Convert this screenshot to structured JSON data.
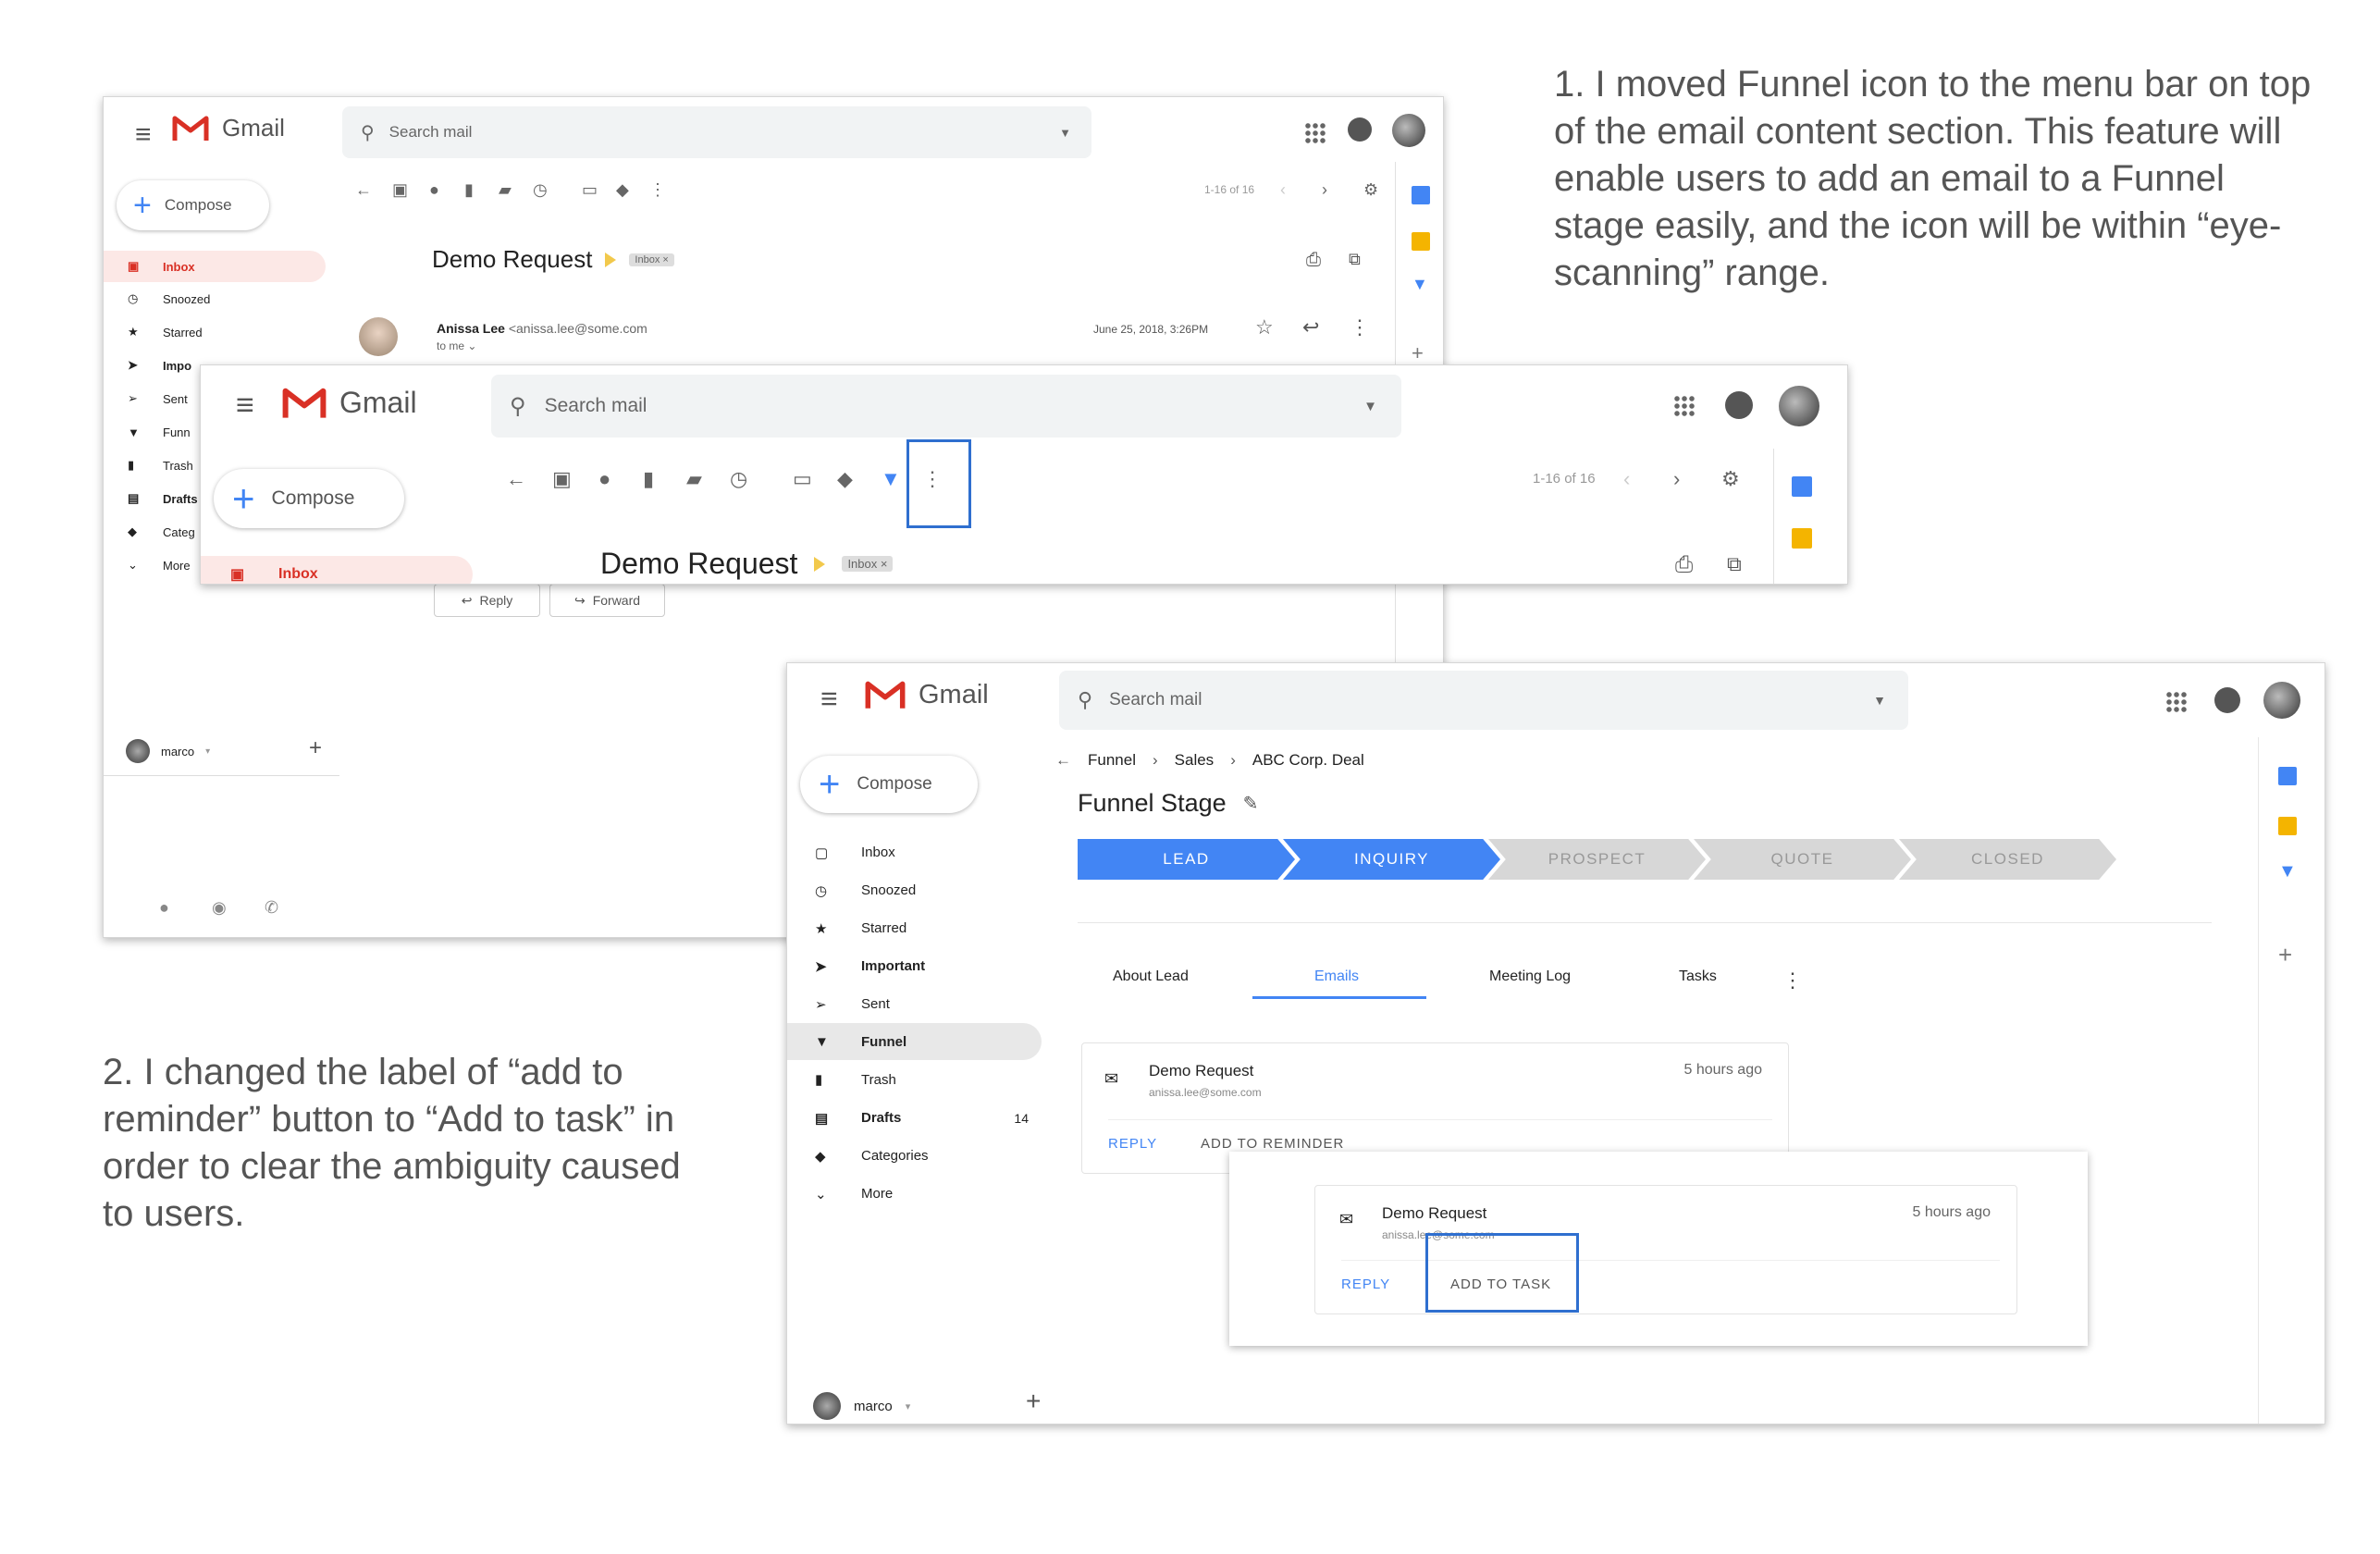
{
  "annotations": {
    "note1": "1. I moved Funnel icon to the menu bar on top of the email content section. This feature will enable users to add an email to a Funnel stage easily, and the icon will be within “eye-scanning” range.",
    "note2": "2.  I changed the label of “add to reminder” button to “Add to task” in order to clear the ambiguity caused to users."
  },
  "app_name": "Gmail",
  "search_placeholder": "Search mail",
  "compose_label": "Compose",
  "email": {
    "subject": "Demo Request",
    "label_chip": "Inbox",
    "chip_close": "×",
    "sender_name": "Anissa Lee",
    "sender_email": "<anissa.lee@some.com",
    "recipient": "to me",
    "date": "June 25, 2018, 3:26PM",
    "reply_label": "Reply",
    "forward_label": "Forward"
  },
  "pagination": "1-16 of 16",
  "sidebar_short": [
    "Inbox",
    "Snoozed",
    "Starred",
    "Impo",
    "Sent",
    "Funn",
    "Trash",
    "Drafts",
    "Categ",
    "More"
  ],
  "sidebar_full": [
    {
      "label": "Inbox",
      "count": ""
    },
    {
      "label": "Snoozed",
      "count": ""
    },
    {
      "label": "Starred",
      "count": ""
    },
    {
      "label": "Important",
      "count": ""
    },
    {
      "label": "Sent",
      "count": ""
    },
    {
      "label": "Funnel",
      "count": ""
    },
    {
      "label": "Trash",
      "count": ""
    },
    {
      "label": "Drafts",
      "count": "14"
    },
    {
      "label": "Categories",
      "count": ""
    },
    {
      "label": "More",
      "count": ""
    }
  ],
  "user": {
    "name": "marco",
    "caret": "▾"
  },
  "funnel": {
    "breadcrumb": [
      "Funnel",
      "Sales",
      "ABC Corp. Deal"
    ],
    "title": "Funnel Stage",
    "stages": [
      {
        "label": "LEAD",
        "active": true
      },
      {
        "label": "INQUIRY",
        "active": true
      },
      {
        "label": "PROSPECT",
        "active": false
      },
      {
        "label": "QUOTE",
        "active": false
      },
      {
        "label": "CLOSED",
        "active": false
      }
    ],
    "tabs": [
      "About Lead",
      "Emails",
      "Meeting Log",
      "Tasks"
    ],
    "active_tab": "Emails"
  },
  "card_email": {
    "subject": "Demo Request",
    "from": "anissa.lee@some.com",
    "time": "5 hours ago",
    "reply_btn": "REPLY",
    "old_action": "ADD TO REMINDER",
    "new_action": "ADD TO TASK"
  },
  "colors": {
    "accent_blue": "#4285f4",
    "gmail_red": "#d93025",
    "stage_inactive": "#d7d7d7",
    "highlight_box": "#2f6fcf"
  }
}
